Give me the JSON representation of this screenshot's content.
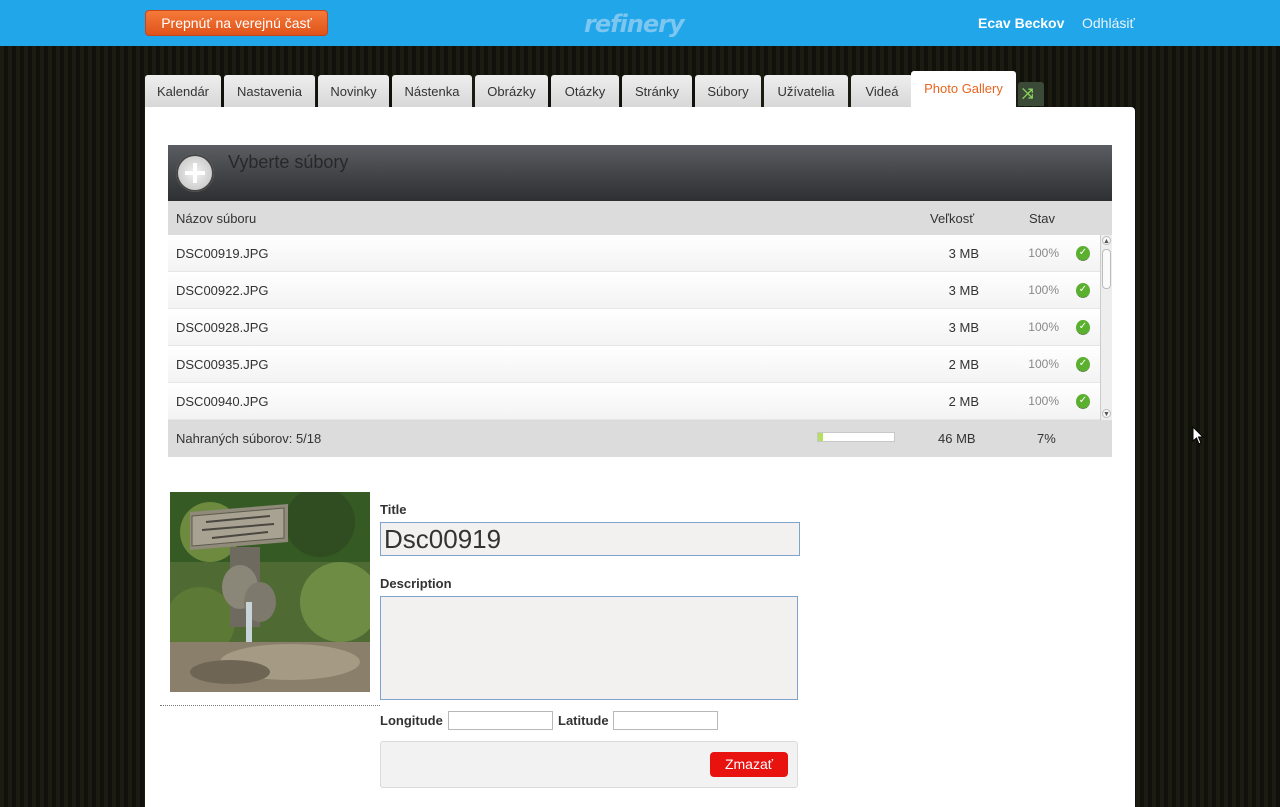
{
  "topbar": {
    "switch_label": "Prepnúť na verejnú časť",
    "logo": "refinery",
    "user_name": "Ecav Beckov",
    "logout_label": "Odhlásiť"
  },
  "tabs": [
    "Kalendár",
    "Nastavenia",
    "Novinky",
    "Nástenka",
    "Obrázky",
    "Otázky",
    "Stránky",
    "Súbory",
    "Užívatelia",
    "Videá",
    "Photo Gallery"
  ],
  "active_tab": "Photo Gallery",
  "uploader": {
    "title": "Vyberte súbory",
    "subtitle": "",
    "columns": {
      "name": "Názov súboru",
      "size": "Veľkosť",
      "status": "Stav"
    },
    "files": [
      {
        "name": "DSC00919.JPG",
        "size": "3 MB",
        "progress": "100%"
      },
      {
        "name": "DSC00922.JPG",
        "size": "3 MB",
        "progress": "100%"
      },
      {
        "name": "DSC00928.JPG",
        "size": "3 MB",
        "progress": "100%"
      },
      {
        "name": "DSC00935.JPG",
        "size": "2 MB",
        "progress": "100%"
      },
      {
        "name": "DSC00940.JPG",
        "size": "2 MB",
        "progress": "100%"
      }
    ],
    "footer": {
      "uploaded_text": "Nahraných súborov: 5/18",
      "total_size": "46 MB",
      "total_percent": "7%",
      "progress_value": 0.07
    }
  },
  "photo_form": {
    "title_label": "Title",
    "title_value": "Dsc00919",
    "description_label": "Description",
    "description_value": "",
    "longitude_label": "Longitude",
    "latitude_label": "Latitude",
    "delete_label": "Zmazať"
  },
  "colors": {
    "topbar": "#22a6ea",
    "accent": "#e8651f",
    "delete": "#e8120e",
    "success": "#5cb030"
  }
}
